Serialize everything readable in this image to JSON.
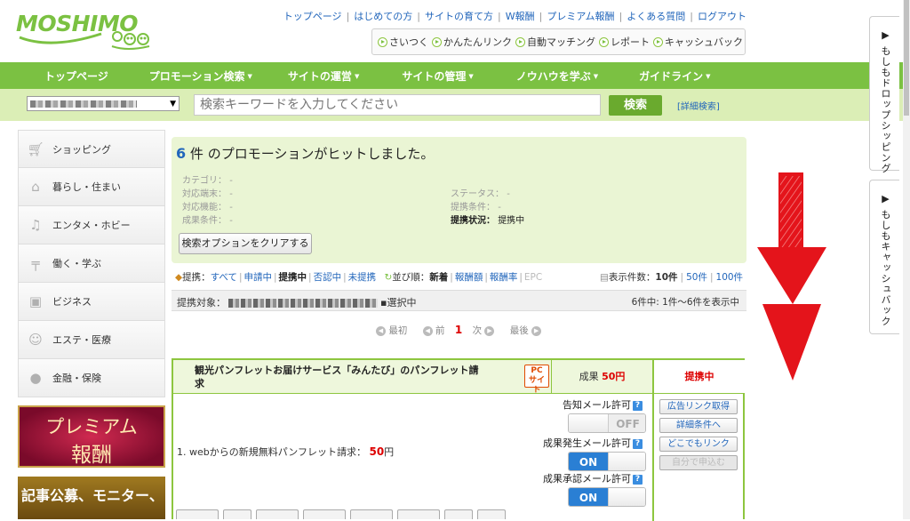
{
  "header": {
    "logo_text": "MOSHIMO",
    "top_links": [
      "トップページ",
      "はじめての方",
      "サイトの育て方",
      "W報酬",
      "プレミアム報酬",
      "よくある質問",
      "ログアウト"
    ],
    "sub_links": [
      "さいつく",
      "かんたんリンク",
      "自動マッチング",
      "レポート",
      "キャッシュバック"
    ]
  },
  "main_nav": [
    {
      "label": "トップページ",
      "caret": false
    },
    {
      "label": "プロモーション検索",
      "caret": true
    },
    {
      "label": "サイトの運営",
      "caret": true
    },
    {
      "label": "サイトの管理",
      "caret": true
    },
    {
      "label": "ノウハウを学ぶ",
      "caret": true
    },
    {
      "label": "ガイドライン",
      "caret": true
    }
  ],
  "search": {
    "placeholder": "検索キーワードを入力してください",
    "button": "検索",
    "advanced": "[詳細検索]"
  },
  "sidebar": {
    "categories": [
      {
        "label": "ショッピング",
        "icon": "cart-icon"
      },
      {
        "label": "暮らし・住まい",
        "icon": "house-icon"
      },
      {
        "label": "エンタメ・ホビー",
        "icon": "music-icon"
      },
      {
        "label": "働く・学ぶ",
        "icon": "desk-icon"
      },
      {
        "label": "ビジネス",
        "icon": "briefcase-icon"
      },
      {
        "label": "エステ・医療",
        "icon": "face-icon"
      },
      {
        "label": "金融・保険",
        "icon": "piggy-bank-icon"
      }
    ],
    "banner_premium_line1": "プレミアム",
    "banner_premium_line2": "報酬",
    "banner_article": "記事公募、モニター、"
  },
  "results": {
    "count": "6",
    "hit_text": "件 のプロモーションがヒットしました。",
    "criteria_left": [
      {
        "label": "カテゴリ：",
        "value": "-"
      },
      {
        "label": "対応端末：",
        "value": "-"
      },
      {
        "label": "対応機能：",
        "value": "-"
      },
      {
        "label": "成果条件：",
        "value": "-"
      }
    ],
    "criteria_right": [
      {
        "label": "ステータス：",
        "value": "-"
      },
      {
        "label": "提携条件：",
        "value": "-"
      },
      {
        "label": "提携状況：",
        "value": "提携中"
      }
    ],
    "clear_button": "検索オプションをクリアする"
  },
  "filters": {
    "tie_label": "提携：",
    "tie_options": [
      "すべて",
      "申請中",
      "提携中",
      "否認中",
      "未提携"
    ],
    "tie_active": "提携中",
    "sort_label": "並び順：",
    "sort_options": [
      "新着",
      "報酬額",
      "報酬率",
      "EPC"
    ],
    "sort_active": "新着",
    "perpage_label": "表示件数：",
    "perpage_options": [
      "10件",
      "50件",
      "100件"
    ],
    "perpage_active": "10件"
  },
  "target": {
    "label": "提携対象：",
    "suffix": "▪選択中",
    "range": "6件中: 1件～6件を表示中"
  },
  "pager": {
    "first": "最初",
    "prev": "前",
    "current": "1",
    "next": "次",
    "last": "最後"
  },
  "card": {
    "title": "観光パンフレットお届けサービス「みんたび」のパンフレット請求",
    "pc_badge_line1": "PC",
    "pc_badge_line2": "サイト",
    "reward_label": "成果",
    "reward_value": "50円",
    "status": "提携中",
    "line_item": "1. webからの新規無料パンフレット請求：",
    "line_amount": "50",
    "line_unit": "円",
    "mail_settings": [
      {
        "label": "告知メール許可",
        "state": "OFF"
      },
      {
        "label": "成果発生メール許可",
        "state": "ON"
      },
      {
        "label": "成果承認メール許可",
        "state": "ON"
      }
    ],
    "actions": [
      {
        "label": "広告リンク取得",
        "enabled": true
      },
      {
        "label": "詳細条件へ",
        "enabled": true
      },
      {
        "label": "どこでもリンク",
        "enabled": true
      },
      {
        "label": "自分で申込む",
        "enabled": false
      }
    ]
  },
  "side_tabs": [
    "もしもドロップシッピング",
    "もしもキャッシュバック"
  ],
  "colors": {
    "brand_green": "#7bc142",
    "light_green": "#dbeeb6",
    "panel_green": "#eaf5d4",
    "link_blue": "#2266bb",
    "accent_red": "#dd0000",
    "toggle_blue": "#2a7fd4",
    "annotation_arrow": "#e4141b"
  }
}
